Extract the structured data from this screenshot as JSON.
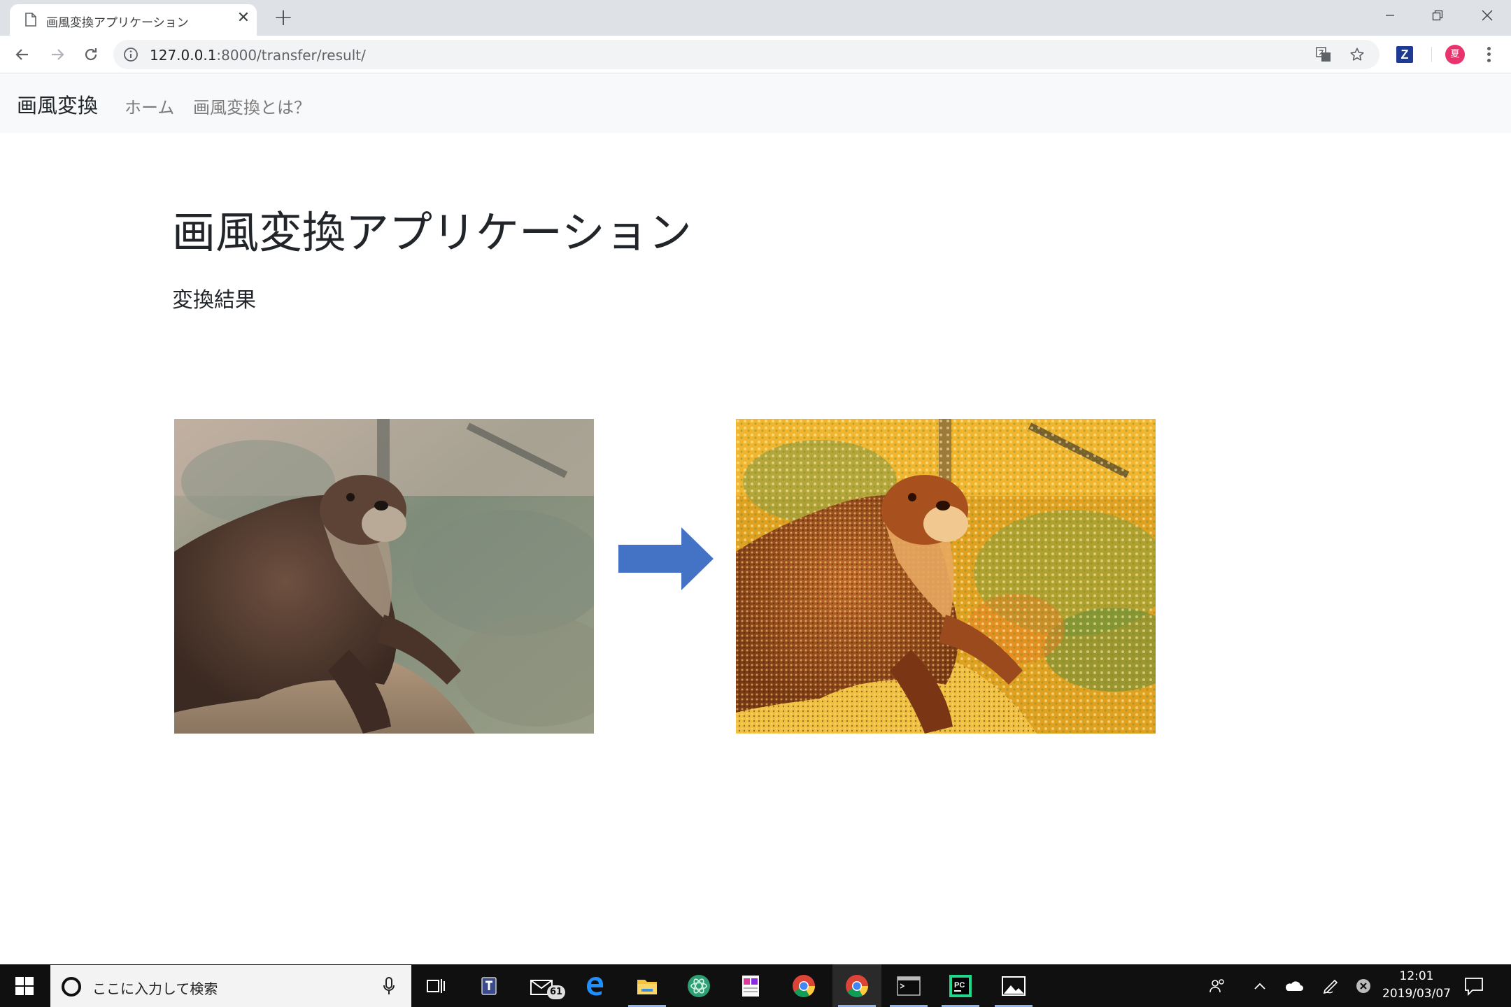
{
  "browser": {
    "tab_title": "画風変換アプリケーション",
    "tab_close_glyph": "✕",
    "new_tab_glyph": "+",
    "url_host": "127.0.0.1",
    "url_rest": ":8000/transfer/result/",
    "profile_initial": "夏",
    "extension_letter": "Z"
  },
  "navbar": {
    "brand": "画風変換",
    "links": [
      "ホーム",
      "画風変換とは？"
    ]
  },
  "main": {
    "title": "画風変換アプリケーション",
    "subtitle": "変換結果"
  },
  "taskbar": {
    "search_placeholder": "ここに入力して検索",
    "mail_badge": "61",
    "time": "12:01",
    "date": "2019/03/07"
  },
  "colors": {
    "arrow": "#4472c4",
    "navbar_bg": "#f8f9fa",
    "tab_strip": "#dee1e6",
    "taskbar": "#101010"
  },
  "icons": [
    "page-icon",
    "back-icon",
    "forward-icon",
    "reload-icon",
    "info-icon",
    "translate-icon",
    "star-icon",
    "windows-icon",
    "microphone-icon",
    "arrow-right-icon"
  ]
}
